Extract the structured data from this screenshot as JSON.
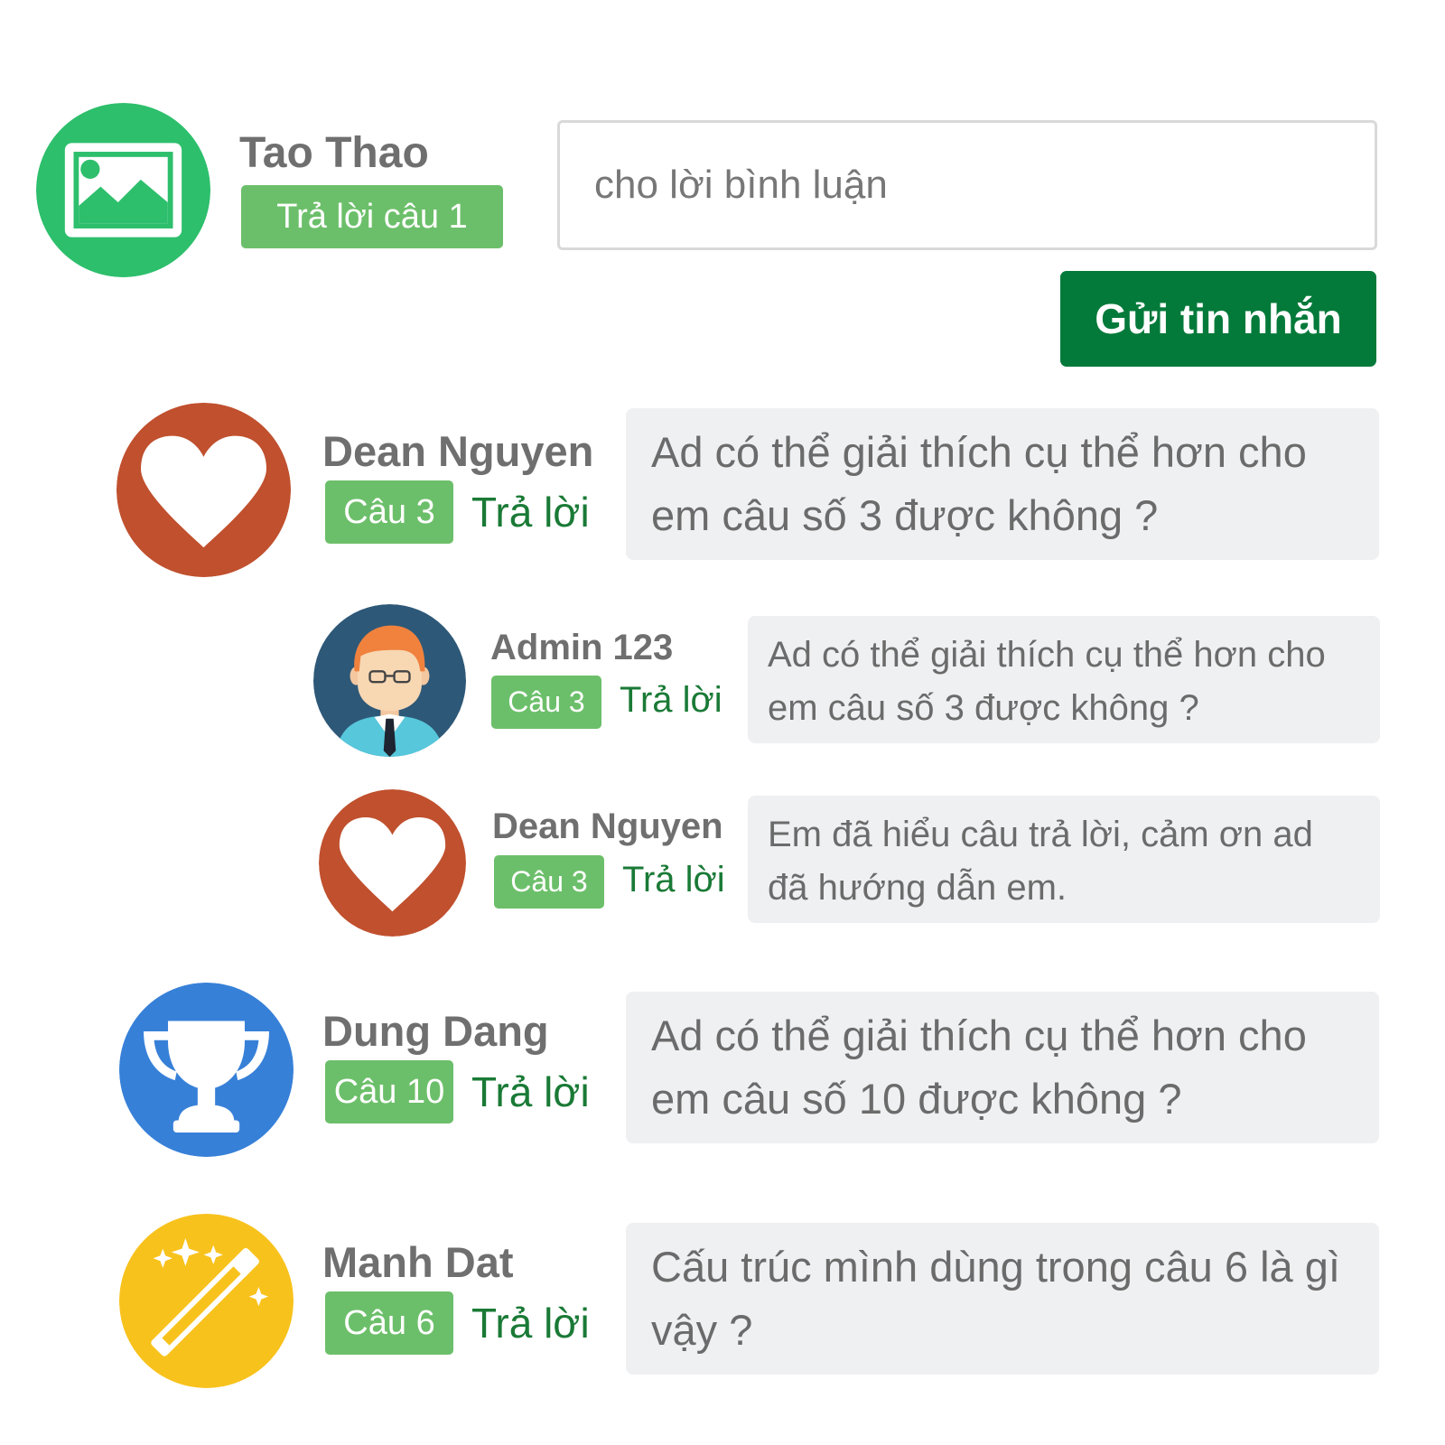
{
  "composer": {
    "user_name": "Tao Thao",
    "badge_label": "Trả lời câu 1",
    "input_placeholder": "cho lời bình luận",
    "input_value": "",
    "send_label": "Gửi tin nhắn",
    "avatar_icon": "image-icon"
  },
  "comments": [
    {
      "author": "Dean Nguyen",
      "badge": "Câu 3",
      "reply_label": "Trả lời",
      "text": "Ad có thể giải thích cụ thể hơn cho em câu số 3 được không ?",
      "avatar_icon": "heart-icon",
      "avatar_color": "#c0502e",
      "replies": [
        {
          "author": "Admin 123",
          "badge": "Câu 3",
          "reply_label": "Trả lời",
          "text": "Ad có thể giải thích cụ thể hơn cho em câu số 3 được không ?",
          "avatar_icon": "admin-person-icon",
          "avatar_color": "#2e5877"
        },
        {
          "author": "Dean Nguyen",
          "badge": "Câu 3",
          "reply_label": "Trả lời",
          "text": "Em đã hiểu câu trả lời, cảm ơn ad đã hướng dẫn em.",
          "avatar_icon": "heart-icon",
          "avatar_color": "#c0502e"
        }
      ]
    },
    {
      "author": "Dung Dang",
      "badge": "Câu 10",
      "reply_label": "Trả lời",
      "text": "Ad có thể giải thích cụ thể hơn cho em câu số 10 được không ?",
      "avatar_icon": "trophy-icon",
      "avatar_color": "#3780d8"
    },
    {
      "author": "Manh Dat",
      "badge": "Câu 6",
      "reply_label": "Trả lời",
      "text": "Cấu trúc mình dùng trong câu 6 là gì vậy ?",
      "avatar_icon": "magic-wand-icon",
      "avatar_color": "#f8c21d"
    }
  ],
  "colors": {
    "badge_green": "#6cbf6a",
    "send_button": "#047a3a",
    "reply_link": "#1a7a36",
    "bubble_bg": "#eff0f2"
  }
}
